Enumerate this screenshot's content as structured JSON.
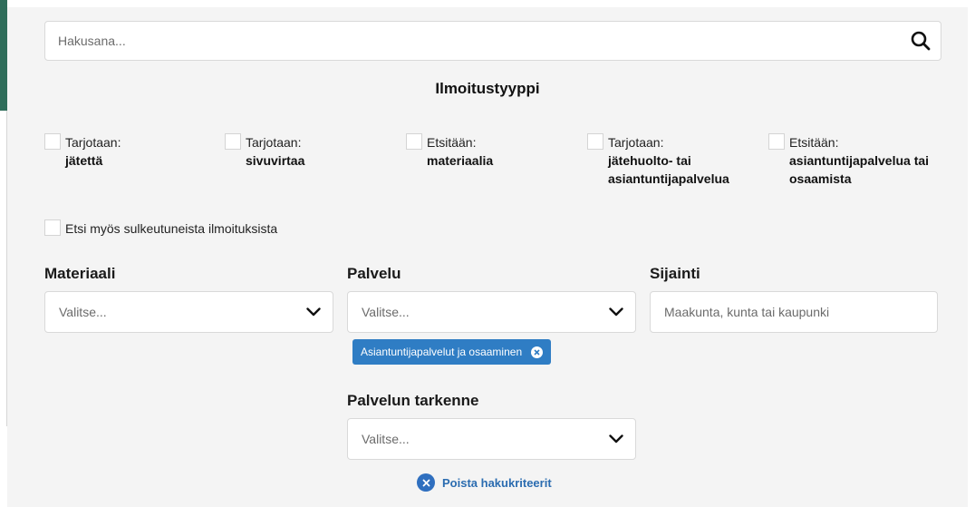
{
  "search": {
    "placeholder": "Hakusana..."
  },
  "announcement_type": {
    "title": "Ilmoitustyyppi",
    "options": [
      {
        "prefix": "Tarjotaan:",
        "value": "jätettä"
      },
      {
        "prefix": "Tarjotaan:",
        "value": "sivuvirtaa"
      },
      {
        "prefix": "Etsitään:",
        "value": "materiaalia"
      },
      {
        "prefix": "Tarjotaan:",
        "value": "jätehuolto- tai asiantuntijapalvelua"
      },
      {
        "prefix": "Etsitään:",
        "value": "asiantuntijapalvelua tai osaamista"
      }
    ],
    "closed_label": "Etsi myös sulkeutuneista ilmoituksista"
  },
  "filters": {
    "material": {
      "label": "Materiaali",
      "placeholder": "Valitse..."
    },
    "service": {
      "label": "Palvelu",
      "placeholder": "Valitse...",
      "selected_tag": "Asiantuntijapalvelut ja osaaminen"
    },
    "location": {
      "label": "Sijainti",
      "placeholder": "Maakunta, kunta tai kaupunki"
    },
    "service_detail": {
      "label": "Palvelun tarkenne",
      "placeholder": "Valitse..."
    }
  },
  "clear_label": "Poista hakukriteerit",
  "colors": {
    "accent_blue": "#2f7dc4",
    "brand_green": "#2f6d5a",
    "panel_bg": "#f4f4f4"
  }
}
